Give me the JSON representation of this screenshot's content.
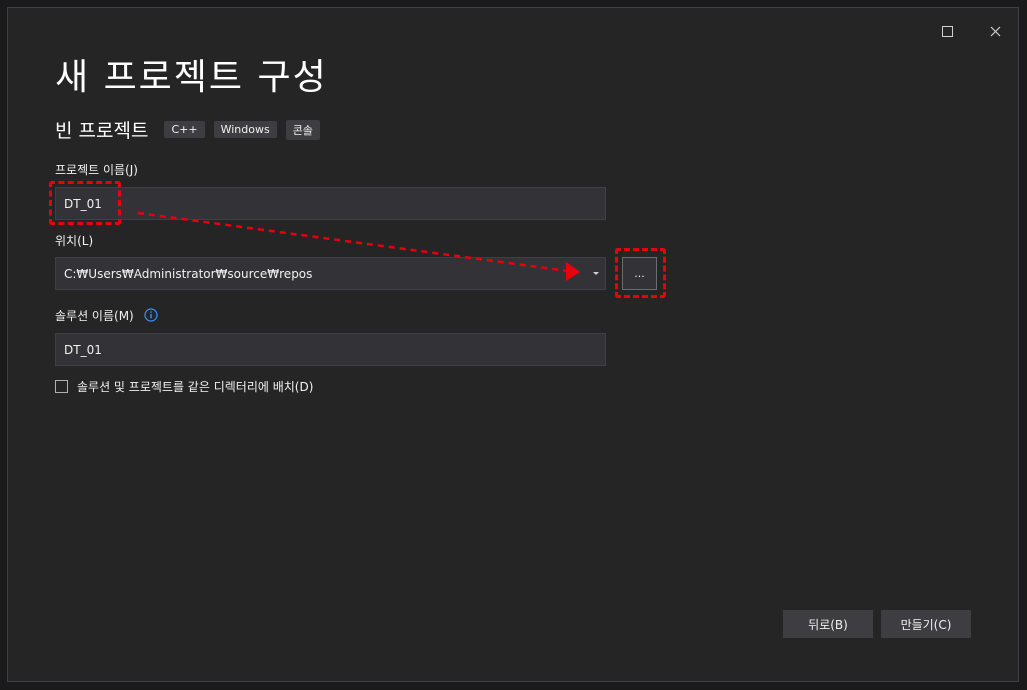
{
  "window": {
    "maximize_icon": "maximize-icon",
    "close_icon": "close-icon"
  },
  "header": {
    "title": "새 프로젝트 구성",
    "template_name": "빈 프로젝트",
    "tags": [
      "C++",
      "Windows",
      "콘솔"
    ]
  },
  "form": {
    "project_name_label": "프로젝트 이름(J)",
    "project_name_value": "DT_01",
    "location_label": "위치(L)",
    "location_value": "C:₩Users₩Administrator₩source₩repos",
    "browse_label": "...",
    "solution_name_label": "솔루션 이름(M)",
    "solution_name_value": "DT_01",
    "same_dir_checkbox_label": "솔루션 및 프로젝트를 같은 디렉터리에 배치(D)",
    "same_dir_checked": false
  },
  "footer": {
    "back_label": "뒤로(B)",
    "create_label": "만들기(C)"
  },
  "colors": {
    "background": "#252526",
    "field": "#333337",
    "annotation_red": "#e8000d",
    "info_blue": "#3794ff"
  }
}
